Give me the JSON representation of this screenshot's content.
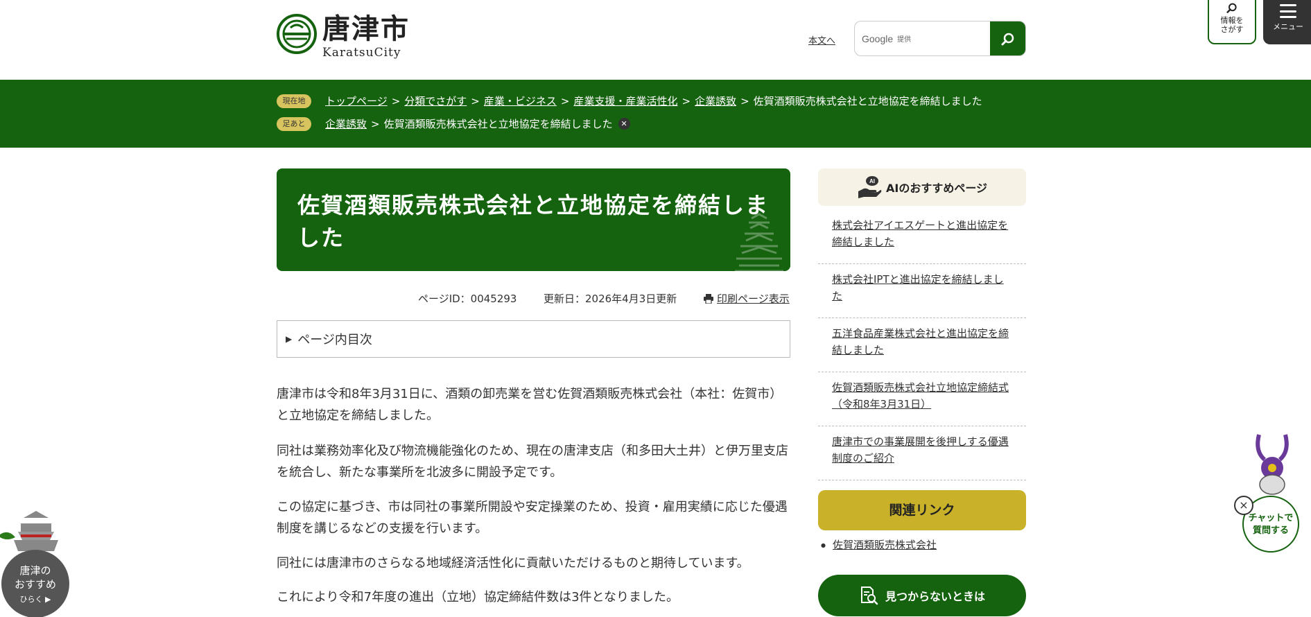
{
  "header": {
    "logo_jp": "唐津市",
    "logo_en": "KaratsuCity",
    "skip_link": "本文へ",
    "search_google": "Google",
    "search_provided": "提供",
    "info_button": [
      "情報を",
      "さがす"
    ],
    "menu_button": "メニュー"
  },
  "breadcrumb": {
    "current_tag": "現在地",
    "trail": [
      "トップページ",
      "分類でさがす",
      "産業・ビジネス",
      "産業支援・産業活性化",
      "企業誘致"
    ],
    "current": "佐賀酒類販売株式会社と立地協定を締結しました",
    "history_tag": "足あと",
    "history_link": "企業誘致",
    "history_current": "佐賀酒類販売株式会社と立地協定を締結しました",
    "history_close": "✕"
  },
  "article": {
    "title": "佐賀酒類販売株式会社と立地協定を締結しました",
    "page_id": "ページID：0045293",
    "updated": "更新日：2026年4月3日更新",
    "print": "印刷ページ表示",
    "toc_label": "ページ内目次",
    "paragraphs": [
      "唐津市は令和8年3月31日に、酒類の卸売業を営む佐賀酒類販売株式会社（本社：佐賀市）と立地協定を締結しました。",
      "同社は業務効率化及び物流機能強化のため、現在の唐津支店（和多田大土井）と伊万里支店を統合し、新たな事業所を北波多に開設予定です。",
      "この協定に基づき、市は同社の事業所開設や安定操業のため、投資・雇用実績に応じた優遇制度を講じるなどの支援を行います。",
      "同社には唐津市のさらなる地域経済活性化に貢献いただけるものと期待しています。",
      "これにより令和7年度の進出（立地）協定締結件数は3件となりました。"
    ]
  },
  "sidebar": {
    "ai_title": "AIのおすすめページ",
    "ai_items": [
      "株式会社アイエスゲートと進出協定を締結しました",
      "株式会社IPTと進出協定を締結しました",
      "五洋食品産業株式会社と進出協定を締結しました",
      "佐賀酒類販売株式会社立地協定締結式（令和8年3月31日）",
      "唐津市での事業展開を後押しする優遇制度のご紹介"
    ],
    "related_title": "関連リンク",
    "related_items": [
      "佐賀酒類販売株式会社"
    ],
    "notfound": "見つからないときは"
  },
  "widgets": {
    "osusume_line1": "唐津の",
    "osusume_line2": "おすすめ",
    "osusume_open": "ひらく",
    "chat_line1": "チャットで",
    "chat_line2": "質問する"
  },
  "colors": {
    "primary_green": "#15620f",
    "gold": "#c9b22a",
    "crumb_tag": "#d8c45e",
    "ai_bg": "#f6f3e6"
  }
}
